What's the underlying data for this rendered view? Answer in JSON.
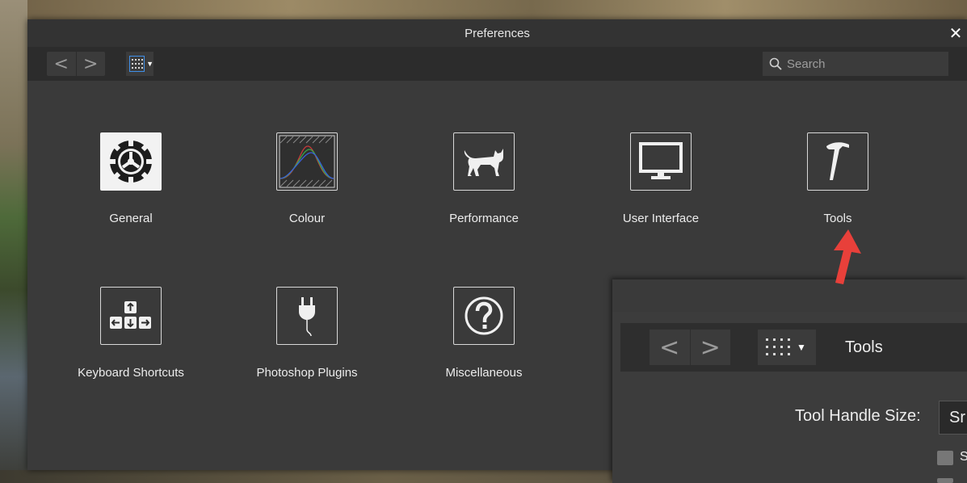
{
  "dialog": {
    "title": "Preferences",
    "close_glyph": "✕"
  },
  "toolbar": {
    "back_glyph": "<",
    "forward_glyph": ">",
    "view_icon": "grid-icon",
    "search_placeholder": "Search"
  },
  "categories": [
    {
      "label": "General",
      "icon": "gear-icon"
    },
    {
      "label": "Colour",
      "icon": "colour-curves-icon"
    },
    {
      "label": "Performance",
      "icon": "cat-icon"
    },
    {
      "label": "User Interface",
      "icon": "monitor-icon"
    },
    {
      "label": "Tools",
      "icon": "hammer-icon"
    },
    {
      "label": "Keyboard Shortcuts",
      "icon": "keyboard-arrows-icon"
    },
    {
      "label": "Photoshop Plugins",
      "icon": "plug-icon"
    },
    {
      "label": "Miscellaneous",
      "icon": "question-icon"
    }
  ],
  "tools_dialog": {
    "breadcrumb": "Tools",
    "handle_size_label": "Tool Handle Size:",
    "handle_size_value": "Sr",
    "checkbox_label": "S"
  },
  "colors": {
    "accent": "#3f8fe8",
    "annotation_arrow": "#e8403a",
    "dialog_bg": "#3a3a3a",
    "toolbar_bg": "#2c2c2c"
  }
}
